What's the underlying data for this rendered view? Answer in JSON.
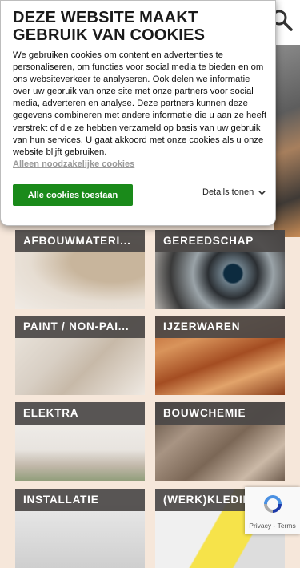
{
  "header": {
    "search_icon": "search-icon"
  },
  "categories": [
    {
      "label": "AFBOUWMATERI..."
    },
    {
      "label": "GEREEDSCHAP"
    },
    {
      "label": "PAINT / NON-PAI..."
    },
    {
      "label": "IJZERWAREN"
    },
    {
      "label": "ELEKTRA"
    },
    {
      "label": "BOUWCHEMIE"
    },
    {
      "label": "INSTALLATIE"
    },
    {
      "label": "(WERK)KLEDING ..."
    }
  ],
  "cookie_modal": {
    "title": "DEZE WEBSITE MAAKT GEBRUIK VAN COOKIES",
    "body": "We gebruiken cookies om content en advertenties te personaliseren, om functies voor social media te bieden en om ons websiteverkeer te analyseren. Ook delen we informatie over uw gebruik van onze site met onze partners voor social media, adverteren en analyse. Deze partners kunnen deze gegevens combineren met andere informatie die u aan ze heeft verstrekt of die ze hebben verzameld op basis van uw gebruik van hun services. U gaat akkoord met onze cookies als u onze website blijft gebruiken.",
    "necessary_link": "Alleen noodzakelijke cookies",
    "accept_button": "Alle cookies toestaan",
    "details_label": "Details tonen",
    "accent_color": "#1a8a1a"
  },
  "recaptcha": {
    "terms": "Privacy - Terms"
  }
}
